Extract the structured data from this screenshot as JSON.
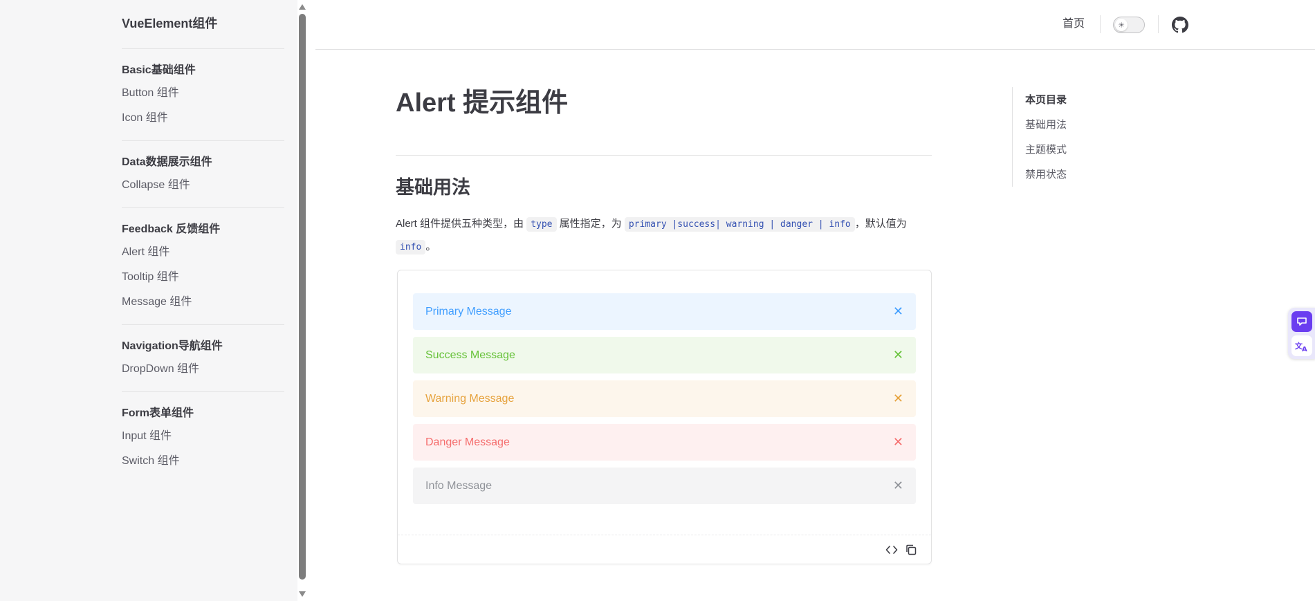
{
  "sidebar": {
    "site_title": "VueElement组件",
    "groups": [
      {
        "title": "Basic基础组件",
        "items": [
          "Button 组件",
          "Icon 组件"
        ]
      },
      {
        "title": "Data数据展示组件",
        "items": [
          "Collapse 组件"
        ]
      },
      {
        "title": "Feedback 反馈组件",
        "items": [
          "Alert 组件",
          "Tooltip 组件",
          "Message 组件"
        ]
      },
      {
        "title": "Navigation导航组件",
        "items": [
          "DropDown 组件"
        ]
      },
      {
        "title": "Form表单组件",
        "items": [
          "Input 组件",
          "Switch 组件"
        ]
      }
    ]
  },
  "header": {
    "home_label": "首页",
    "theme_toggle_icon": "sun-icon",
    "github_icon": "github-icon"
  },
  "main": {
    "page_title": "Alert 提示组件",
    "section_title": "基础用法",
    "desc_prefix": "Alert 组件提供五种类型，由",
    "desc_code1": "type",
    "desc_mid": "属性指定，为",
    "desc_code2": "primary |success| warning | danger | info",
    "desc_suffix": "，默认值为",
    "desc_code3": "info",
    "desc_end": "。",
    "alerts": [
      {
        "type": "primary",
        "message": "Primary Message",
        "close": "✕"
      },
      {
        "type": "success",
        "message": "Success Message",
        "close": "✕"
      },
      {
        "type": "warning",
        "message": "Warning Message",
        "close": "✕"
      },
      {
        "type": "danger",
        "message": "Danger Message",
        "close": "✕"
      },
      {
        "type": "info",
        "message": "Info Message",
        "close": "✕"
      }
    ]
  },
  "toc": {
    "title": "本页目录",
    "items": [
      "基础用法",
      "主题模式",
      "禁用状态"
    ]
  },
  "colors": {
    "primary": "#409eff",
    "success": "#67c23a",
    "warning": "#e6a23c",
    "danger": "#f56c6c",
    "info": "#909399",
    "widget_accent": "#6a3df0"
  }
}
